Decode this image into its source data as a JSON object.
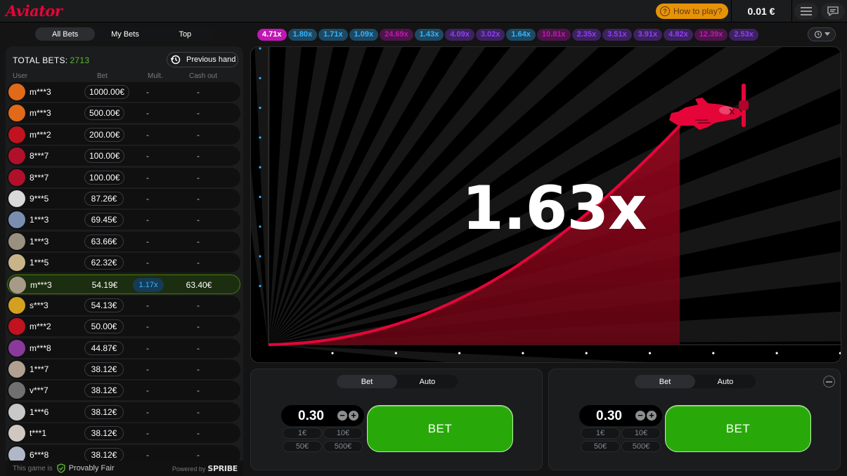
{
  "header": {
    "logo": "Aviator",
    "how_to_play": "How to play?",
    "balance": "0.01 €"
  },
  "bets_tabs": [
    "All Bets",
    "My Bets",
    "Top"
  ],
  "total_bets_label": "TOTAL BETS:",
  "total_bets_count": "2713",
  "previous_hand": "Previous hand",
  "columns": {
    "user": "User",
    "bet": "Bet",
    "mult": "Mult.",
    "cashout": "Cash out"
  },
  "rows": [
    {
      "user": "m***3",
      "bet": "1000.00€",
      "mult": "-",
      "cashout": "-",
      "avatar_color": "#e06a1a",
      "win": false
    },
    {
      "user": "m***3",
      "bet": "500.00€",
      "mult": "-",
      "cashout": "-",
      "avatar_color": "#e06a1a",
      "win": false
    },
    {
      "user": "m***2",
      "bet": "200.00€",
      "mult": "-",
      "cashout": "-",
      "avatar_color": "#c0121f",
      "win": false
    },
    {
      "user": "8***7",
      "bet": "100.00€",
      "mult": "-",
      "cashout": "-",
      "avatar_color": "#b0102a",
      "win": false
    },
    {
      "user": "8***7",
      "bet": "100.00€",
      "mult": "-",
      "cashout": "-",
      "avatar_color": "#b0102a",
      "win": false
    },
    {
      "user": "9***5",
      "bet": "87.26€",
      "mult": "-",
      "cashout": "-",
      "avatar_color": "#d9d9d9",
      "win": false
    },
    {
      "user": "1***3",
      "bet": "69.45€",
      "mult": "-",
      "cashout": "-",
      "avatar_color": "#7a8fb0",
      "win": false
    },
    {
      "user": "1***3",
      "bet": "63.66€",
      "mult": "-",
      "cashout": "-",
      "avatar_color": "#9a9080",
      "win": false
    },
    {
      "user": "1***5",
      "bet": "62.32€",
      "mult": "-",
      "cashout": "-",
      "avatar_color": "#c9b48a",
      "win": false
    },
    {
      "user": "m***3",
      "bet": "54.19€",
      "mult": "1.17x",
      "cashout": "63.40€",
      "avatar_color": "#a89a88",
      "win": true
    },
    {
      "user": "s***3",
      "bet": "54.13€",
      "mult": "-",
      "cashout": "-",
      "avatar_color": "#d4a020",
      "win": false
    },
    {
      "user": "m***2",
      "bet": "50.00€",
      "mult": "-",
      "cashout": "-",
      "avatar_color": "#c0121f",
      "win": false
    },
    {
      "user": "m***8",
      "bet": "44.87€",
      "mult": "-",
      "cashout": "-",
      "avatar_color": "#8a3a9a",
      "win": false
    },
    {
      "user": "1***7",
      "bet": "38.12€",
      "mult": "-",
      "cashout": "-",
      "avatar_color": "#b0a090",
      "win": false
    },
    {
      "user": "v***7",
      "bet": "38.12€",
      "mult": "-",
      "cashout": "-",
      "avatar_color": "#707070",
      "win": false
    },
    {
      "user": "1***6",
      "bet": "38.12€",
      "mult": "-",
      "cashout": "-",
      "avatar_color": "#c8c8c8",
      "win": false
    },
    {
      "user": "t***1",
      "bet": "38.12€",
      "mult": "-",
      "cashout": "-",
      "avatar_color": "#d0c8c0",
      "win": false
    },
    {
      "user": "6***8",
      "bet": "38.12€",
      "mult": "-",
      "cashout": "-",
      "avatar_color": "#b0b8c8",
      "win": false
    }
  ],
  "footer": {
    "this_game_is": "This game is",
    "provably_fair": "Provably Fair",
    "powered_by": "Powered by",
    "brand": "SPRIBE"
  },
  "history": [
    {
      "value": "4.71x",
      "color": "#c017b4"
    },
    {
      "value": "1.80x",
      "color": "#34b4ff"
    },
    {
      "value": "1.71x",
      "color": "#34b4ff"
    },
    {
      "value": "1.09x",
      "color": "#34b4ff"
    },
    {
      "value": "24.69x",
      "color": "#c017b4"
    },
    {
      "value": "1.43x",
      "color": "#34b4ff"
    },
    {
      "value": "4.09x",
      "color": "#913ef8"
    },
    {
      "value": "3.02x",
      "color": "#913ef8"
    },
    {
      "value": "1.64x",
      "color": "#34b4ff"
    },
    {
      "value": "10.81x",
      "color": "#c017b4"
    },
    {
      "value": "2.35x",
      "color": "#913ef8"
    },
    {
      "value": "3.51x",
      "color": "#913ef8"
    },
    {
      "value": "3.91x",
      "color": "#913ef8"
    },
    {
      "value": "4.82x",
      "color": "#913ef8"
    },
    {
      "value": "12.39x",
      "color": "#c017b4"
    },
    {
      "value": "2.53x",
      "color": "#913ef8"
    }
  ],
  "game": {
    "multiplier": "1.63x",
    "accent": "#e50539"
  },
  "bet_panels": [
    {
      "tabs": [
        "Bet",
        "Auto"
      ],
      "amount": "0.30",
      "quick": [
        "1€",
        "10€",
        "50€",
        "500€"
      ],
      "button": "BET"
    },
    {
      "tabs": [
        "Bet",
        "Auto"
      ],
      "amount": "0.30",
      "quick": [
        "1€",
        "10€",
        "50€",
        "500€"
      ],
      "button": "BET"
    }
  ]
}
